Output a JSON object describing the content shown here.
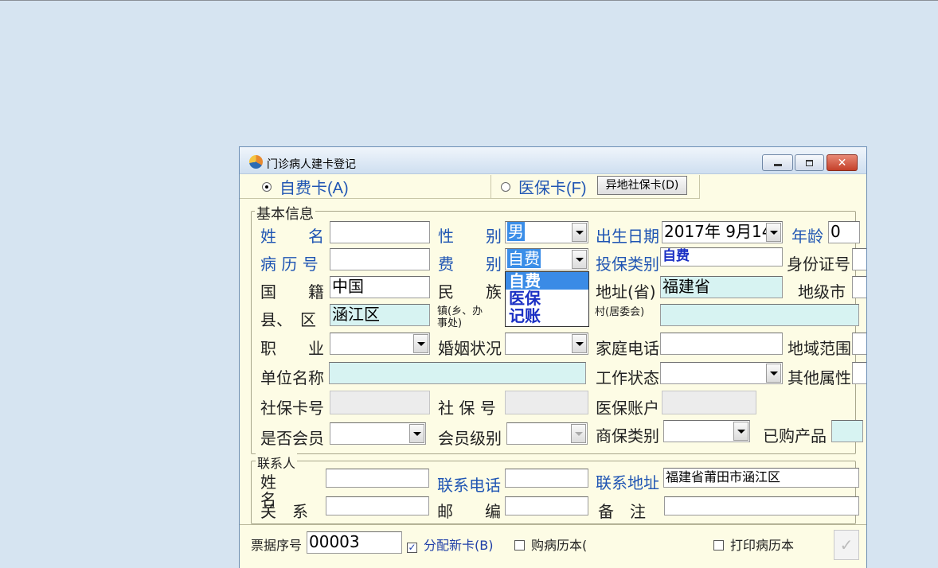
{
  "window": {
    "title": "门诊病人建卡登记",
    "icon": "app-logo-icon"
  },
  "card_type": {
    "self_pay": {
      "label": "自费卡(A)",
      "selected": true
    },
    "insurance": {
      "label": "医保卡(F)",
      "selected": false
    },
    "remote_btn": "异地社保卡(D)"
  },
  "basic": {
    "legend": "基本信息",
    "name_label": "姓　　名",
    "name_value": "",
    "gender_label": "性　　别",
    "gender_value": "男",
    "birth_label": "出生日期",
    "birth_value": "2017年  9月14",
    "age_label": "年龄",
    "age_value": "0",
    "record_label": "病 历 号",
    "record_value": "",
    "fee_label": "费　　别",
    "fee_value": "自费",
    "insure_type_label": "投保类别",
    "insure_type_value": "自费",
    "id_label": "身份证号",
    "nation_label": "国　　籍",
    "nation_value": "中国",
    "ethnic_label": "民　　族",
    "addr_prov_label": "地址(省)",
    "addr_prov_value": "福建省",
    "city_label": "地级市",
    "county_label": "县、　区",
    "county_value": "涵江区",
    "town_label": "镇(乡、办事处)",
    "village_label": "村(居委会)",
    "village_value": "",
    "job_label": "职　　业",
    "marriage_label": "婚姻状况",
    "home_phone_label": "家庭电话",
    "region_label": "地域范围",
    "unit_label": "单位名称",
    "unit_value": "",
    "work_status_label": "工作状态",
    "other_attr_label": "其他属性",
    "ss_card_label": "社保卡号",
    "ss_no_label": "社 保 号",
    "med_account_label": "医保账户",
    "member_label": "是否会员",
    "member_level_label": "会员级别",
    "comm_ins_label": "商保类别",
    "purchased_label": "已购产品"
  },
  "fee_dropdown": {
    "options": [
      "自费",
      "医保",
      "记账"
    ],
    "highlighted": "自费"
  },
  "contact": {
    "legend": "联系人",
    "name_label": "姓　　名",
    "phone_label": "联系电话",
    "addr_label": "联系地址",
    "addr_value": "福建省莆田市涵江区",
    "relation_label": "关　系",
    "zip_label": "邮　　编",
    "note_label": "备　注"
  },
  "bottom": {
    "receipt_label": "票据序号",
    "receipt_value": "00003",
    "new_card_label": "分配新卡(B)",
    "new_card_checked": true,
    "buy_record_label": "购病历本(",
    "buy_record_checked": false,
    "print_record_label": "打印病历本",
    "print_record_checked": false
  }
}
